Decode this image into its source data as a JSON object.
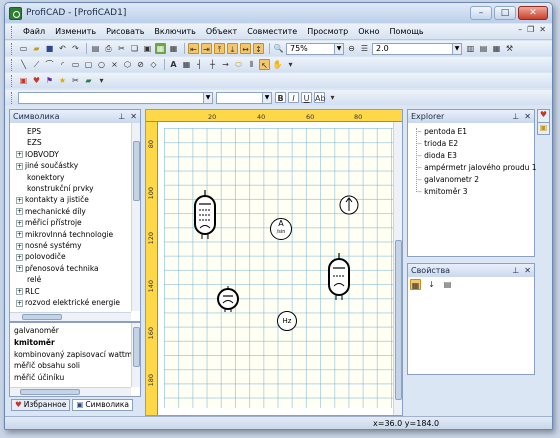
{
  "window": {
    "title": "ProfiCAD - [ProfiCAD1]"
  },
  "menu": [
    "Файл",
    "Изменить",
    "Рисовать",
    "Включить",
    "Объект",
    "Совместите",
    "Просмотр",
    "Окно",
    "Помощь"
  ],
  "toolbar": {
    "zoom": "75%",
    "line_width": "2.0"
  },
  "symbols_panel": {
    "title": "Символика",
    "items": [
      {
        "label": "EPS",
        "expander": ""
      },
      {
        "label": "EZS",
        "expander": ""
      },
      {
        "label": "IOBVODY",
        "expander": "+"
      },
      {
        "label": "jiné součástky",
        "expander": "+"
      },
      {
        "label": "konektory",
        "expander": ""
      },
      {
        "label": "konstrukční prvky",
        "expander": ""
      },
      {
        "label": "kontakty a jističe",
        "expander": "+"
      },
      {
        "label": "mechanické díly",
        "expander": "+"
      },
      {
        "label": "měřicí přístroje",
        "expander": "+"
      },
      {
        "label": "mikrovlnná technologie",
        "expander": "+"
      },
      {
        "label": "nosné systémy",
        "expander": "+"
      },
      {
        "label": "polovodiče",
        "expander": "+"
      },
      {
        "label": "přenosová technika",
        "expander": "+"
      },
      {
        "label": "relé",
        "expander": ""
      },
      {
        "label": "RLC",
        "expander": "+"
      },
      {
        "label": "rozvod elektrické energie",
        "expander": "+"
      }
    ],
    "list": [
      "galvanoměr",
      "kmitoměr",
      "kombinovaný zapisovací wattmě",
      "měřič obsahu soli",
      "měřič účiníku"
    ],
    "tabs": [
      "Избранное",
      "Символика"
    ]
  },
  "ruler": {
    "top": [
      "20",
      "40",
      "60",
      "80"
    ],
    "left": [
      "80",
      "100",
      "120",
      "140",
      "160",
      "180"
    ]
  },
  "explorer": {
    "title": "Explorer",
    "items": [
      "pentoda E1",
      "trioda E2",
      "dioda E3",
      "ampérmetr jalového proudu 1",
      "galvanometr 2",
      "kmitoměr 3"
    ]
  },
  "properties": {
    "title": "Свойства"
  },
  "status": {
    "coords": "x=36.0  y=184.0"
  },
  "canvas_labels": {
    "ammeter": "A",
    "ammeter_sub": "/sin",
    "hz": "Hz"
  },
  "colors": {
    "ruler": "#ffd84a",
    "grid": "#78b4d2",
    "accent": "#f4c66e"
  }
}
